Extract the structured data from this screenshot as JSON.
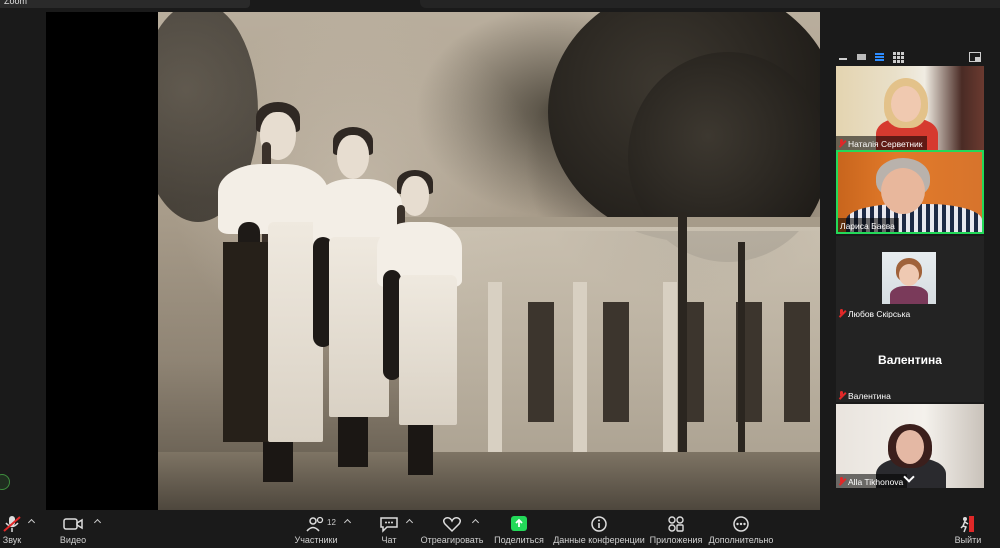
{
  "window": {
    "title": "Zoom"
  },
  "gallery": {
    "participants": [
      {
        "name": "Наталія Серветник",
        "muted": true
      },
      {
        "name": "Лариса Баєва",
        "muted": false,
        "active": true
      },
      {
        "name": "Любов Скірська",
        "muted": true
      },
      {
        "name": "Валентина",
        "muted": true,
        "display_name": "Валентина"
      },
      {
        "name": "Alla Tikhonova",
        "muted": true
      }
    ]
  },
  "toolbar": {
    "audio_label": "Звук",
    "video_label": "Видео",
    "participants_label": "Участники",
    "participants_count": "12",
    "chat_label": "Чат",
    "react_label": "Отреагировать",
    "share_label": "Поделиться",
    "info_label": "Данные конференции",
    "apps_label": "Приложения",
    "more_label": "Дополнительно",
    "leave_label": "Выйти"
  },
  "colors": {
    "share_green": "#23d959",
    "muted_red": "#e02828",
    "leave_red": "#e02828",
    "toolbar_bg": "#1a1a1a"
  }
}
